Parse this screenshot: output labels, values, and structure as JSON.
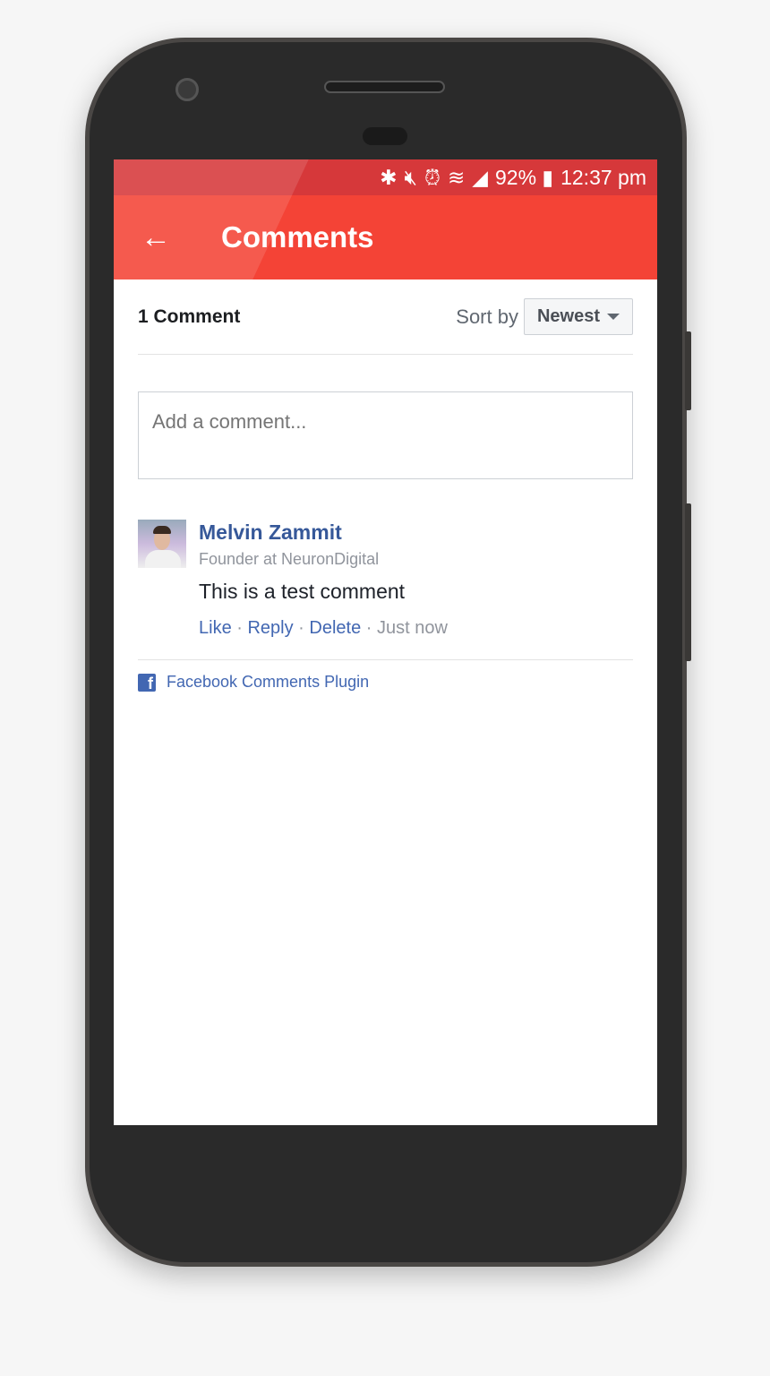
{
  "status_bar": {
    "icons": [
      "bluetooth-icon",
      "mute-icon",
      "alarm-icon",
      "wifi-icon",
      "signal-icon"
    ],
    "battery": "92%",
    "time": "12:37 pm"
  },
  "app_bar": {
    "title": "Comments",
    "back_icon": "arrow-left-icon",
    "color": "#f44336"
  },
  "comments": {
    "count_label": "1 Comment",
    "sort_label": "Sort by",
    "sort_value": "Newest",
    "input_placeholder": "Add a comment...",
    "items": [
      {
        "author": "Melvin Zammit",
        "subtitle": "Founder at NeuronDigital",
        "text": "This is a test comment",
        "like": "Like",
        "reply": "Reply",
        "delete": "Delete",
        "time": "Just now"
      }
    ],
    "footer": "Facebook Comments Plugin"
  }
}
